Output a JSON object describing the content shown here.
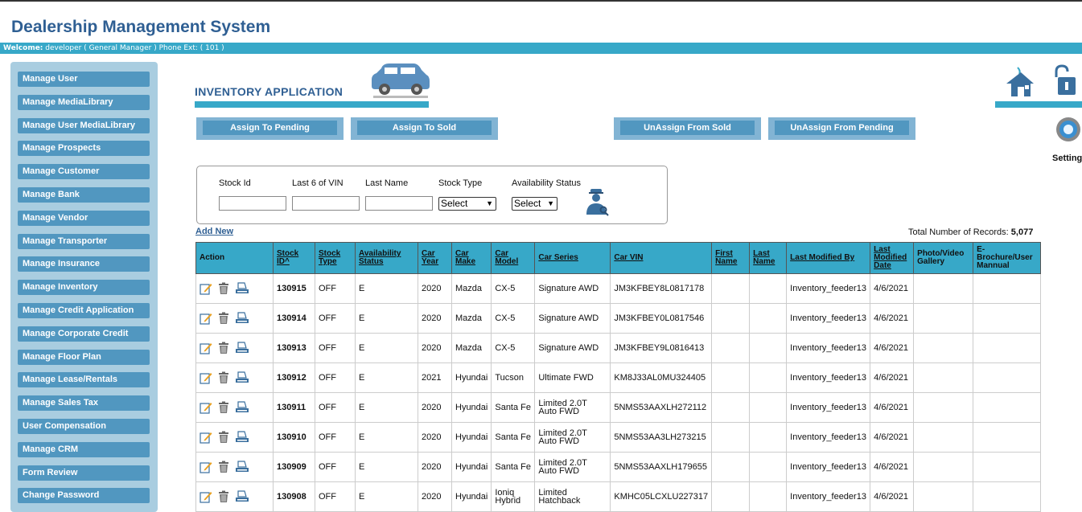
{
  "app_title": "Dealership Management System",
  "welcome": {
    "label": "Welcome:",
    "text": "developer ( General Manager ) Phone Ext: ( 101 )"
  },
  "sidebar": {
    "items": [
      {
        "label": "Manage User"
      },
      {
        "label": "Manage MediaLibrary"
      },
      {
        "label": "Manage User MediaLibrary"
      },
      {
        "label": "Manage Prospects"
      },
      {
        "label": "Manage Customer"
      },
      {
        "label": "Manage Bank"
      },
      {
        "label": "Manage Vendor"
      },
      {
        "label": "Manage Transporter"
      },
      {
        "label": "Manage Insurance"
      },
      {
        "label": "Manage Inventory"
      },
      {
        "label": "Manage Credit Application"
      },
      {
        "label": "Manage Corporate Credit"
      },
      {
        "label": "Manage Floor Plan"
      },
      {
        "label": "Manage Lease/Rentals"
      },
      {
        "label": "Manage Sales Tax"
      },
      {
        "label": "User Compensation"
      },
      {
        "label": "Manage CRM"
      },
      {
        "label": "Form Review"
      },
      {
        "label": "Change Password"
      }
    ]
  },
  "page_title": "INVENTORY APPLICATION",
  "actions": {
    "assign_pending": "Assign To Pending",
    "assign_sold": "Assign To Sold",
    "unassign_sold": "UnAssign From Sold",
    "unassign_pending": "UnAssign From Pending"
  },
  "search": {
    "stock_id_label": "Stock Id",
    "vin_label": "Last 6 of VIN",
    "last_name_label": "Last Name",
    "stock_type_label": "Stock Type",
    "availability_label": "Availability Status",
    "stock_type_value": "Select",
    "availability_value": "Select"
  },
  "add_new": "Add New",
  "total": {
    "label": "Total Number of Records:",
    "value": "5,077"
  },
  "settings_label": "Setting",
  "table": {
    "headers": {
      "action": "Action",
      "stock_id": "Stock ID",
      "stock_type": "Stock Type",
      "availability": "Availability Status",
      "year": "Car Year",
      "make": "Car Make",
      "model": "Car Model",
      "series": "Car Series",
      "vin": "Car VIN",
      "first_name": "First Name",
      "last_name": "Last Name",
      "modified_by": "Last Modified By",
      "modified_date": "Last Modified Date",
      "gallery": "Photo/Video Gallery",
      "brochure": "E-Brochure/User Mannual"
    },
    "rows": [
      {
        "stock_id": "130915",
        "type": "OFF",
        "status": "E",
        "year": "2020",
        "make": "Mazda",
        "model": "CX-5",
        "series": "Signature AWD",
        "vin": "JM3KFBEY8L0817178",
        "first": "",
        "last": "",
        "modified_by": "Inventory_feeder13",
        "date": "4/6/2021"
      },
      {
        "stock_id": "130914",
        "type": "OFF",
        "status": "E",
        "year": "2020",
        "make": "Mazda",
        "model": "CX-5",
        "series": "Signature AWD",
        "vin": "JM3KFBEY0L0817546",
        "first": "",
        "last": "",
        "modified_by": "Inventory_feeder13",
        "date": "4/6/2021"
      },
      {
        "stock_id": "130913",
        "type": "OFF",
        "status": "E",
        "year": "2020",
        "make": "Mazda",
        "model": "CX-5",
        "series": "Signature AWD",
        "vin": "JM3KFBEY9L0816413",
        "first": "",
        "last": "",
        "modified_by": "Inventory_feeder13",
        "date": "4/6/2021"
      },
      {
        "stock_id": "130912",
        "type": "OFF",
        "status": "E",
        "year": "2021",
        "make": "Hyundai",
        "model": "Tucson",
        "series": "Ultimate FWD",
        "vin": "KM8J33AL0MU324405",
        "first": "",
        "last": "",
        "modified_by": "Inventory_feeder13",
        "date": "4/6/2021"
      },
      {
        "stock_id": "130911",
        "type": "OFF",
        "status": "E",
        "year": "2020",
        "make": "Hyundai",
        "model": "Santa Fe",
        "series": "Limited 2.0T Auto FWD",
        "vin": "5NMS53AAXLH272112",
        "first": "",
        "last": "",
        "modified_by": "Inventory_feeder13",
        "date": "4/6/2021"
      },
      {
        "stock_id": "130910",
        "type": "OFF",
        "status": "E",
        "year": "2020",
        "make": "Hyundai",
        "model": "Santa Fe",
        "series": "Limited 2.0T Auto FWD",
        "vin": "5NMS53AA3LH273215",
        "first": "",
        "last": "",
        "modified_by": "Inventory_feeder13",
        "date": "4/6/2021"
      },
      {
        "stock_id": "130909",
        "type": "OFF",
        "status": "E",
        "year": "2020",
        "make": "Hyundai",
        "model": "Santa Fe",
        "series": "Limited 2.0T Auto FWD",
        "vin": "5NMS53AAXLH179655",
        "first": "",
        "last": "",
        "modified_by": "Inventory_feeder13",
        "date": "4/6/2021"
      },
      {
        "stock_id": "130908",
        "type": "OFF",
        "status": "E",
        "year": "2020",
        "make": "Hyundai",
        "model": "Ioniq Hybrid",
        "series": "Limited Hatchback",
        "vin": "KMHC05LCXLU227317",
        "first": "",
        "last": "",
        "modified_by": "Inventory_feeder13",
        "date": "4/6/2021"
      }
    ]
  },
  "icons": {
    "edit": "edit-icon",
    "delete": "trash-icon",
    "print": "print-icon",
    "home": "home-icon",
    "logout": "unlock-icon",
    "settings": "gear-icon",
    "car": "car-icon",
    "search_agent": "search-user-icon"
  },
  "colors": {
    "title": "#2f5f93",
    "bar": "#37a8c8",
    "button": "#5197c0",
    "sidebar_bg": "#a9cde0"
  }
}
